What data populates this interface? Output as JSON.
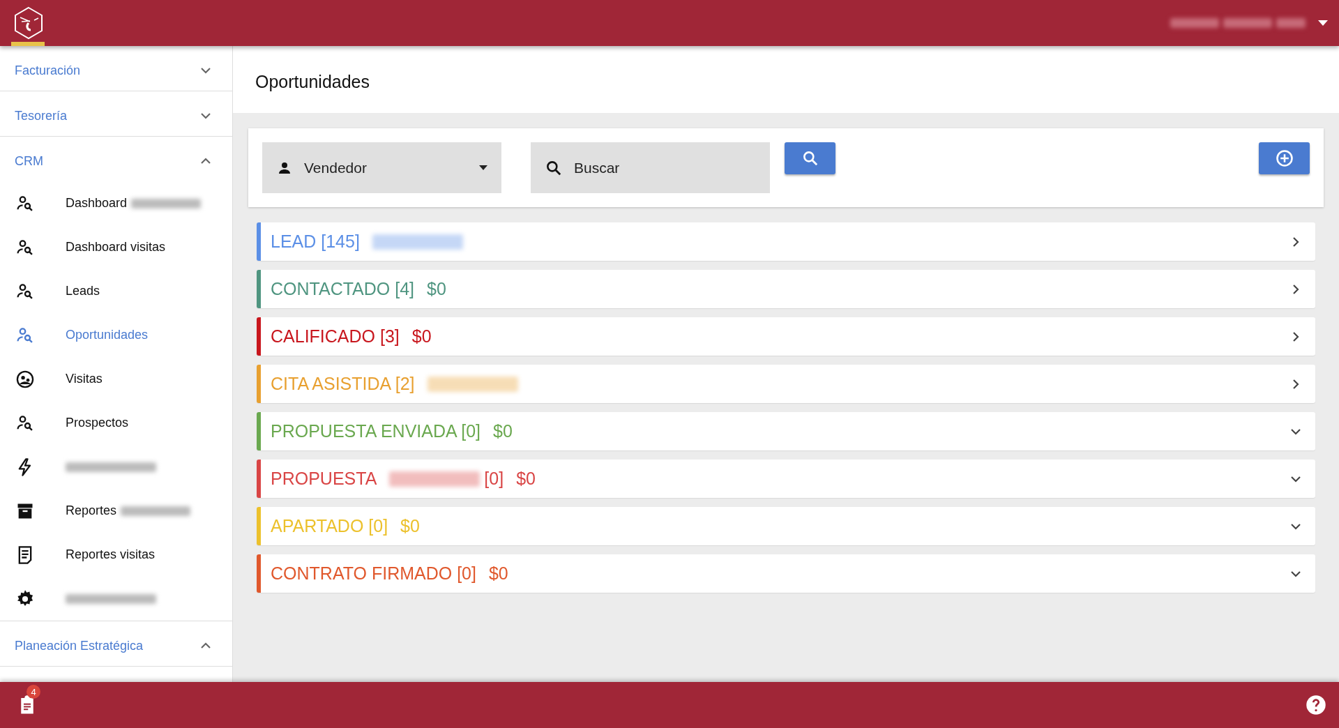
{
  "header": {
    "user_menu": {
      "redacted": true
    }
  },
  "sidebar": {
    "sections": [
      {
        "title": "Facturación",
        "expanded": false
      },
      {
        "title": "Tesorería",
        "expanded": false
      },
      {
        "title": "CRM",
        "expanded": true,
        "items": [
          {
            "label": "Dashboard",
            "redacted": true,
            "selected": false
          },
          {
            "label": "Dashboard visitas",
            "redacted": false,
            "selected": false
          },
          {
            "label": "Leads",
            "redacted": false,
            "selected": false
          },
          {
            "label": "Oportunidades",
            "redacted": false,
            "selected": true
          },
          {
            "label": "Visitas",
            "redacted": false,
            "selected": false
          },
          {
            "label": "Prospectos",
            "redacted": false,
            "selected": false
          },
          {
            "redacted": true,
            "selected": false
          },
          {
            "label": "Reportes",
            "redacted": true,
            "selected": false
          },
          {
            "label": "Reportes visitas",
            "redacted": false,
            "selected": false
          },
          {
            "redacted": true,
            "selected": false
          }
        ]
      },
      {
        "title": "Planeación Estratégica",
        "expanded": true
      }
    ]
  },
  "page": {
    "title": "Oportunidades"
  },
  "filters": {
    "seller": {
      "placeholder": "Vendedor"
    },
    "search": {
      "placeholder": "Buscar"
    }
  },
  "stages": [
    {
      "name": "LEAD [145]",
      "amount_redacted": true,
      "color": "#5b8fe6",
      "expanded": false
    },
    {
      "name": "CONTACTADO [4]",
      "amount": "$0",
      "color": "#4f9580",
      "expanded": false
    },
    {
      "name": "CALIFICADO [3]",
      "amount": "$0",
      "color": "#c8161d",
      "expanded": false
    },
    {
      "name": "CITA ASISTIDA [2]",
      "amount_redacted": true,
      "color": "#e8a030",
      "expanded": false
    },
    {
      "name": "PROPUESTA ENVIADA [0]",
      "amount": "$0",
      "color": "#6aa84f",
      "expanded": true
    },
    {
      "name": "PROPUESTA",
      "name_tail": "[0]",
      "amount": "$0",
      "color": "#d94545",
      "expanded": true
    },
    {
      "name": "APARTADO [0]",
      "amount": "$0",
      "color": "#ecc12c",
      "expanded": true
    },
    {
      "name": "CONTRATO FIRMADO [0]",
      "amount": "$0",
      "color": "#e0582c",
      "expanded": true
    }
  ],
  "footer": {
    "notifications": {
      "count": "4"
    }
  }
}
